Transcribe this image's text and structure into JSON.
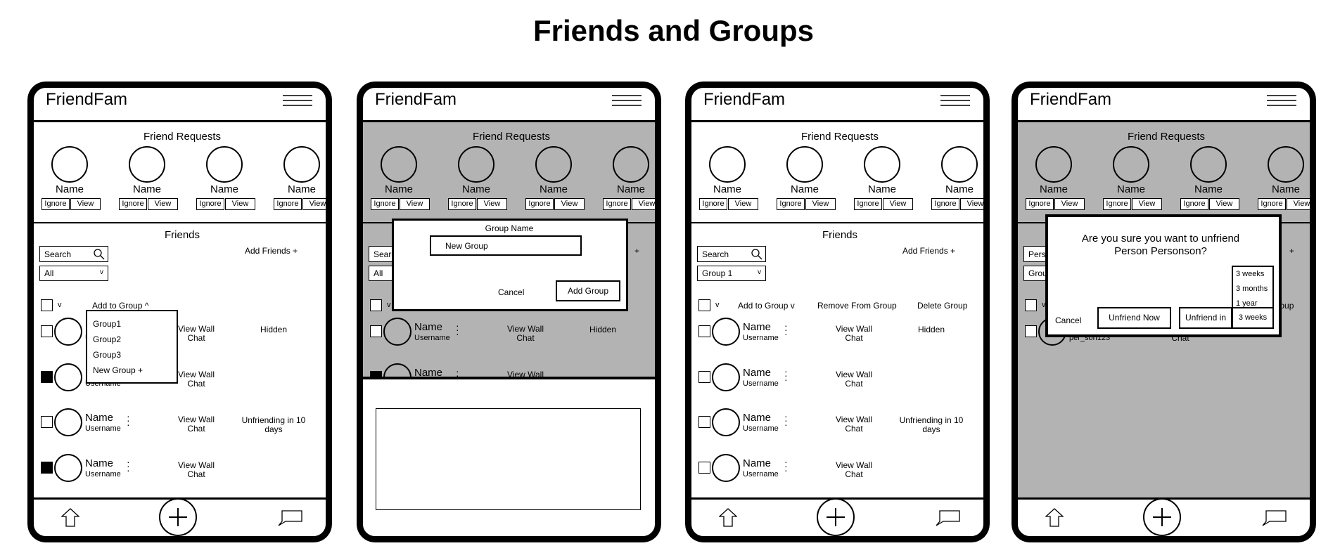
{
  "title": "Friends and Groups",
  "colors": {
    "frame": "#000000",
    "background": "#ffffff",
    "overlay_gray": "#b3b3b3"
  },
  "icons": {
    "menu": "hamburger-icon",
    "search": "search-icon",
    "home": "home-icon",
    "add": "plus-icon",
    "chat": "chat-bubble-icon",
    "more": "vertical-dots-icon"
  },
  "phones": [
    {
      "app_title": "FriendFam",
      "dimmed": false,
      "requests": {
        "label": "Friend Requests",
        "items": [
          {
            "name": "Name",
            "ignore": "Ignore",
            "view": "View"
          },
          {
            "name": "Name",
            "ignore": "Ignore",
            "view": "View"
          },
          {
            "name": "Name",
            "ignore": "Ignore",
            "view": "View"
          },
          {
            "name": "Name",
            "ignore": "Ignore",
            "view": "View"
          }
        ]
      },
      "friends": {
        "label": "Friends",
        "search": "Search",
        "filter": "All",
        "filter_caret": "v",
        "add_friends": "Add Friends +",
        "select_all_caret": "v",
        "actions": [
          "Add to Group ^"
        ],
        "rows": [
          {
            "name": "Name",
            "username": "Username",
            "link1": "View Wall",
            "link2": "Chat",
            "status": "Hidden",
            "checked": false
          },
          {
            "name": "Name",
            "username": "Username",
            "link1": "View Wall",
            "link2": "Chat",
            "status": "",
            "checked": true
          },
          {
            "name": "Name",
            "username": "Username",
            "link1": "View Wall",
            "link2": "Chat",
            "status": "Unfriending in 10 days",
            "checked": false
          },
          {
            "name": "Name",
            "username": "Username",
            "link1": "View Wall",
            "link2": "Chat",
            "status": "",
            "checked": true
          }
        ]
      },
      "group_dropdown": [
        "Group1",
        "Group2",
        "Group3",
        "New Group +"
      ]
    },
    {
      "app_title": "FriendFam",
      "dimmed": true,
      "requests": {
        "label": "Friend Requests",
        "items": [
          {
            "name": "Name",
            "ignore": "Ignore",
            "view": "View"
          },
          {
            "name": "Name",
            "ignore": "Ignore",
            "view": "View"
          },
          {
            "name": "Name",
            "ignore": "Ignore",
            "view": "View"
          },
          {
            "name": "Name",
            "ignore": "Ignore",
            "view": "View"
          }
        ]
      },
      "friends": {
        "label": "",
        "search": "Search",
        "filter": "All",
        "filter_caret": "",
        "add_friends": "+",
        "select_all_caret": "v",
        "actions": [],
        "rows": [
          {
            "name": "Name",
            "username": "Username",
            "link1": "View Wall",
            "link2": "Chat",
            "status": "Hidden",
            "checked": false
          },
          {
            "name": "Name",
            "username": "",
            "link1": "View Wall",
            "link2": "",
            "status": "",
            "checked": true
          }
        ]
      },
      "new_group_dialog": {
        "label": "Group Name",
        "value": "New Group",
        "cancel": "Cancel",
        "confirm": "Add Group"
      },
      "keyboard_area": true
    },
    {
      "app_title": "FriendFam",
      "dimmed": false,
      "requests": {
        "label": "Friend Requests",
        "items": [
          {
            "name": "Name",
            "ignore": "Ignore",
            "view": "View"
          },
          {
            "name": "Name",
            "ignore": "Ignore",
            "view": "View"
          },
          {
            "name": "Name",
            "ignore": "Ignore",
            "view": "View"
          },
          {
            "name": "Name",
            "ignore": "Ignore",
            "view": "View"
          }
        ]
      },
      "friends": {
        "label": "Friends",
        "search": "Search",
        "filter": "Group 1",
        "filter_caret": "v",
        "add_friends": "Add Friends +",
        "select_all_caret": "v",
        "actions": [
          "Add to Group v",
          "Remove From Group",
          "Delete Group"
        ],
        "rows": [
          {
            "name": "Name",
            "username": "Username",
            "link1": "View Wall",
            "link2": "Chat",
            "status": "Hidden",
            "checked": false
          },
          {
            "name": "Name",
            "username": "Username",
            "link1": "View Wall",
            "link2": "Chat",
            "status": "",
            "checked": false
          },
          {
            "name": "Name",
            "username": "Username",
            "link1": "View Wall",
            "link2": "Chat",
            "status": "Unfriending in 10 days",
            "checked": false
          },
          {
            "name": "Name",
            "username": "Username",
            "link1": "View Wall",
            "link2": "Chat",
            "status": "",
            "checked": false
          }
        ]
      }
    },
    {
      "app_title": "FriendFam",
      "dimmed": true,
      "requests": {
        "label": "Friend Requests",
        "items": [
          {
            "name": "Name",
            "ignore": "Ignore",
            "view": "View"
          },
          {
            "name": "Name",
            "ignore": "Ignore",
            "view": "View"
          },
          {
            "name": "Name",
            "ignore": "Ignore",
            "view": "View"
          },
          {
            "name": "Name",
            "ignore": "Ignore",
            "view": "View"
          }
        ]
      },
      "friends": {
        "label": "",
        "search": "Person",
        "filter": "Group 1",
        "filter_caret": "",
        "add_friends": "+",
        "select_all_caret": "v",
        "actions": [
          "",
          "",
          "Delete Group"
        ],
        "rows": [
          {
            "name": "",
            "username": "per_son123",
            "link1": "",
            "link2": "Chat",
            "status": "",
            "checked": false
          }
        ]
      },
      "unfriend_dialog": {
        "message": "Are you sure you want to unfriend Person Personson?",
        "cancel": "Cancel",
        "unfriend_now": "Unfriend Now",
        "unfriend_in": "Unfriend in",
        "duration_selected": "3 weeks",
        "duration_options": [
          "3 weeks",
          "3 months",
          "1 year"
        ]
      }
    }
  ]
}
